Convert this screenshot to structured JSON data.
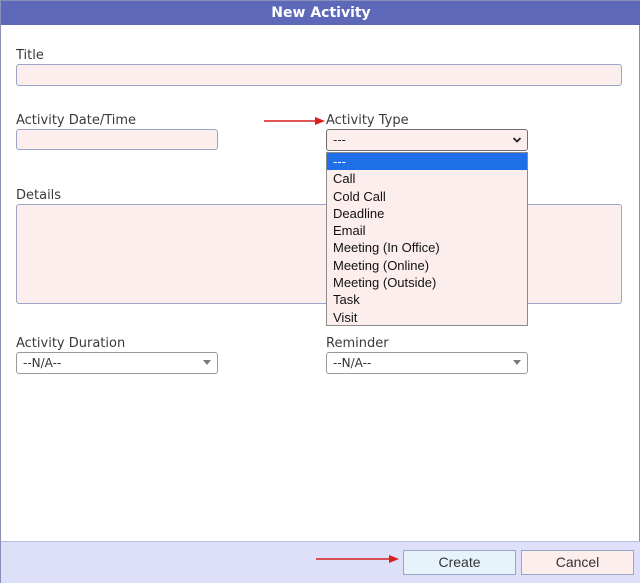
{
  "dialog": {
    "title": "New Activity"
  },
  "form": {
    "title_label": "Title",
    "date_label": "Activity Date/Time",
    "type_label": "Activity Type",
    "type_selected": "---",
    "details_label": "Details",
    "duration_label": "Activity Duration",
    "duration_value": "--N/A--",
    "reminder_label": "Reminder",
    "reminder_value": "--N/A--"
  },
  "dropdown": {
    "options": [
      "---",
      "Call",
      "Cold Call",
      "Deadline",
      "Email",
      "Meeting (In Office)",
      "Meeting (Online)",
      "Meeting (Outside)",
      "Task",
      "Visit"
    ],
    "highlighted_index": 0
  },
  "footer": {
    "create_label": "Create",
    "cancel_label": "Cancel"
  },
  "colors": {
    "titlebar": "#5d68b8",
    "field_bg": "#fdeeee",
    "highlight": "#1e6fe8",
    "footer_bg": "#dedff8",
    "annotation_arrow": "#d81f1f"
  },
  "icons": {
    "select_chevron": "chevron-down-icon",
    "combo_triangle": "caret-down-icon",
    "annotation": "arrow-right-icon"
  }
}
